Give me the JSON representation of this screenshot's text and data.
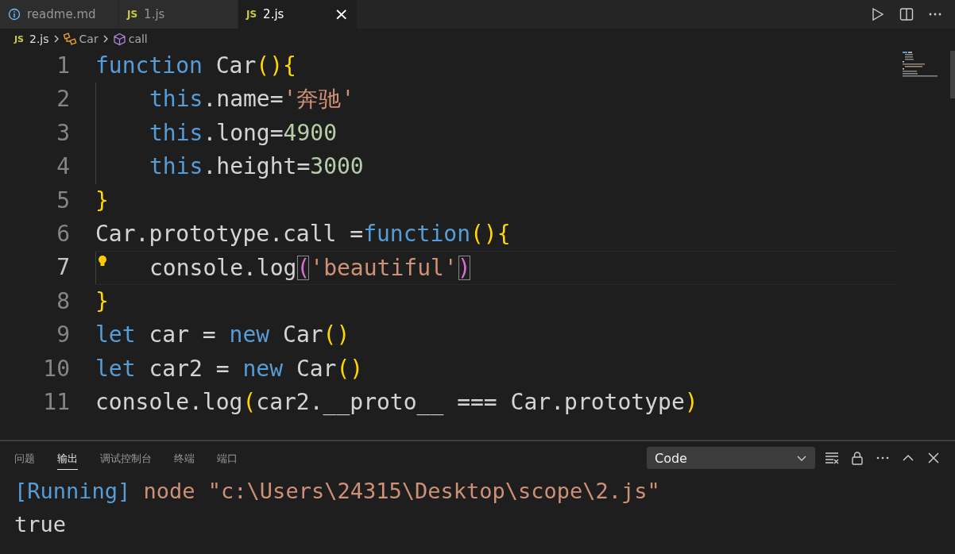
{
  "tabs": [
    {
      "label": "readme.md",
      "kind": "info",
      "selected": false
    },
    {
      "label": "1.js",
      "kind": "js",
      "badge": "JS",
      "selected": false
    },
    {
      "label": "2.js",
      "kind": "js",
      "badge": "JS",
      "selected": true,
      "close": "×"
    }
  ],
  "breadcrumb": [
    {
      "kind": "file",
      "badge": "JS",
      "label": "2.js"
    },
    {
      "kind": "class",
      "label": "Car"
    },
    {
      "kind": "method",
      "label": "call"
    }
  ],
  "editor": {
    "lines": [
      {
        "number": "1",
        "indent": false,
        "current": false,
        "lightbulb": false,
        "tokens": [
          {
            "kind": "kw",
            "text": "function "
          },
          {
            "kind": "id",
            "text": "Car"
          },
          {
            "kind": "br1",
            "text": "(){"
          }
        ]
      },
      {
        "number": "2",
        "indent": true,
        "current": false,
        "lightbulb": false,
        "tokens": [
          {
            "kind": "kw",
            "text": "this"
          },
          {
            "kind": "id",
            "text": ".name="
          },
          {
            "kind": "str",
            "text": "'奔驰'"
          }
        ]
      },
      {
        "number": "3",
        "indent": true,
        "current": false,
        "lightbulb": false,
        "tokens": [
          {
            "kind": "kw",
            "text": "this"
          },
          {
            "kind": "id",
            "text": ".long="
          },
          {
            "kind": "num",
            "text": "4900"
          }
        ]
      },
      {
        "number": "4",
        "indent": true,
        "current": false,
        "lightbulb": false,
        "tokens": [
          {
            "kind": "kw",
            "text": "this"
          },
          {
            "kind": "id",
            "text": ".height="
          },
          {
            "kind": "num",
            "text": "3000"
          }
        ]
      },
      {
        "number": "5",
        "indent": false,
        "current": false,
        "lightbulb": false,
        "tokens": [
          {
            "kind": "br1",
            "text": "}"
          }
        ]
      },
      {
        "number": "6",
        "indent": false,
        "current": false,
        "lightbulb": false,
        "tokens": [
          {
            "kind": "id",
            "text": "Car.prototype.call ="
          },
          {
            "kind": "kw",
            "text": "function"
          },
          {
            "kind": "br1",
            "text": "(){"
          }
        ]
      },
      {
        "number": "7",
        "indent": true,
        "current": true,
        "lightbulb": true,
        "tokens": [
          {
            "kind": "id",
            "text": "console.log"
          },
          {
            "kind": "br2",
            "text": "(",
            "boxed": true
          },
          {
            "kind": "str",
            "text": "'beautiful'"
          },
          {
            "kind": "br2",
            "text": ")",
            "boxed": true
          }
        ]
      },
      {
        "number": "8",
        "indent": false,
        "current": false,
        "lightbulb": false,
        "tokens": [
          {
            "kind": "br1",
            "text": "}"
          }
        ]
      },
      {
        "number": "9",
        "indent": false,
        "current": false,
        "lightbulb": false,
        "tokens": [
          {
            "kind": "kw",
            "text": "let "
          },
          {
            "kind": "id",
            "text": "car = "
          },
          {
            "kind": "kw",
            "text": "new "
          },
          {
            "kind": "id",
            "text": "Car"
          },
          {
            "kind": "br1",
            "text": "()"
          }
        ]
      },
      {
        "number": "10",
        "indent": false,
        "current": false,
        "lightbulb": false,
        "tokens": [
          {
            "kind": "kw",
            "text": "let "
          },
          {
            "kind": "id",
            "text": "car2 = "
          },
          {
            "kind": "kw",
            "text": "new "
          },
          {
            "kind": "id",
            "text": "Car"
          },
          {
            "kind": "br1",
            "text": "()"
          }
        ]
      },
      {
        "number": "11",
        "indent": false,
        "current": false,
        "lightbulb": false,
        "tokens": [
          {
            "kind": "id",
            "text": "console.log"
          },
          {
            "kind": "br1",
            "text": "("
          },
          {
            "kind": "id",
            "text": "car2.__proto__ === Car.prototype"
          },
          {
            "kind": "br1",
            "text": ")"
          }
        ]
      }
    ]
  },
  "panel": {
    "tabs": [
      {
        "label": "问题",
        "selected": false
      },
      {
        "label": "输出",
        "selected": true
      },
      {
        "label": "调试控制台",
        "selected": false
      },
      {
        "label": "终端",
        "selected": false
      },
      {
        "label": "端口",
        "selected": false
      }
    ],
    "channel": "Code",
    "output": [
      {
        "tokens": [
          {
            "kind": "info",
            "text": "[Running]"
          },
          {
            "kind": "str",
            "text": " node \"c:\\Users\\24315\\Desktop\\scope\\2.js\""
          }
        ]
      },
      {
        "tokens": [
          {
            "kind": "plain",
            "text": "true"
          }
        ]
      }
    ]
  }
}
